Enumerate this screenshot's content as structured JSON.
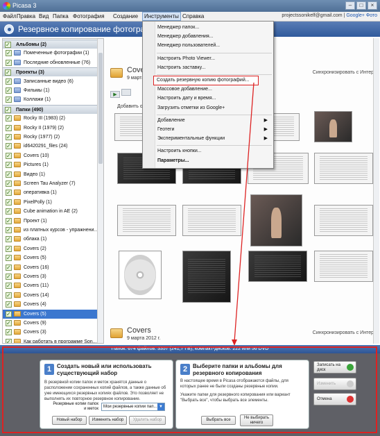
{
  "window": {
    "title": "Picasa 3"
  },
  "menu": {
    "items": [
      "Файл",
      "Правка",
      "Вид",
      "Папка",
      "Фотография",
      "Создание",
      "Инструменты",
      "Справка"
    ],
    "account": "projectssonikelf@gmail.com",
    "google_link": "Google+ Фото"
  },
  "header": {
    "title": "Резервное копирование фотограф"
  },
  "sidebar": {
    "rows": [
      {
        "label": "Альбомы (2)",
        "type": "section"
      },
      {
        "label": "Помеченные фотографии (1)",
        "type": "album"
      },
      {
        "label": "Последние обновленные (76)",
        "type": "album"
      },
      {
        "label": "Проекты (3)",
        "type": "section"
      },
      {
        "label": "Записанные видео (6)",
        "type": "album"
      },
      {
        "label": "Фильмы (1)",
        "type": "album"
      },
      {
        "label": "Коллажи (1)",
        "type": "album"
      },
      {
        "label": "Папки (490)",
        "type": "section"
      },
      {
        "label": "Rocky III (1983) (2)",
        "type": "folder"
      },
      {
        "label": "Rocky II (1979) (2)",
        "type": "folder"
      },
      {
        "label": "Rocky (1977) (2)",
        "type": "folder"
      },
      {
        "label": "id6420291_files (24)",
        "type": "folder"
      },
      {
        "label": "Covers (10)",
        "type": "folder"
      },
      {
        "label": "Pictures (1)",
        "type": "folder"
      },
      {
        "label": "Видео (1)",
        "type": "folder"
      },
      {
        "label": "Screen Tau Analyzer (7)",
        "type": "folder"
      },
      {
        "label": "оперативка (1)",
        "type": "folder"
      },
      {
        "label": "PixelPolly (1)",
        "type": "folder"
      },
      {
        "label": "Cube animation in AE (2)",
        "type": "folder"
      },
      {
        "label": "Проект (1)",
        "type": "folder"
      },
      {
        "label": "из платных курсов - упражнени...",
        "type": "folder"
      },
      {
        "label": "облака (1)",
        "type": "folder"
      },
      {
        "label": "Covers (2)",
        "type": "folder"
      },
      {
        "label": "Covers (5)",
        "type": "folder"
      },
      {
        "label": "Covers (16)",
        "type": "folder"
      },
      {
        "label": "Covers (3)",
        "type": "folder"
      },
      {
        "label": "Covers (11)",
        "type": "folder"
      },
      {
        "label": "Covers (14)",
        "type": "folder"
      },
      {
        "label": "Covers (4)",
        "type": "folder"
      },
      {
        "label": "Covers (5)",
        "type": "folder",
        "selected": true
      },
      {
        "label": "Covers (9)",
        "type": "folder"
      },
      {
        "label": "Covers (3)",
        "type": "folder"
      },
      {
        "label": "Как работать в программе Son...",
        "type": "folder"
      }
    ]
  },
  "main": {
    "album_top": {
      "name": "Covers",
      "date": "9 марта",
      "sync": "Синхронизировать с Интер"
    },
    "add_description": "Добавить о",
    "album_bottom": {
      "name": "Covers",
      "date": "9 марта 2012 г.",
      "sync": "Синхронизировать с Интер"
    }
  },
  "dropdown": {
    "items": [
      {
        "label": "Менеджер папок...",
        "group": 1
      },
      {
        "label": "Менеджер добавления...",
        "group": 1
      },
      {
        "label": "Менеджер пользователей...",
        "group": 1
      },
      {
        "label": "Настроить Photo Viewer...",
        "group": 2
      },
      {
        "label": "Настроить заставку...",
        "group": 2
      },
      {
        "label": "Создать резервную копию фотографий...",
        "group": 3,
        "highlight": true
      },
      {
        "label": "Массовое добавление...",
        "group": 3
      },
      {
        "label": "Настроить дату и время...",
        "group": 3
      },
      {
        "label": "Загрузить отметки из Google+",
        "group": 3
      },
      {
        "label": "Добавление",
        "group": 4,
        "submenu": true
      },
      {
        "label": "Геотеги",
        "group": 4,
        "submenu": true
      },
      {
        "label": "Экспериментальные функции",
        "group": 4,
        "submenu": true
      },
      {
        "label": "Настроить кнопки...",
        "group": 5
      },
      {
        "label": "Параметры...",
        "group": 5,
        "bold": true
      }
    ]
  },
  "status": {
    "text": "Папок: 674 файлов: 3357 (241,7 ГБ), компакт-дисков: 222  или  56 DVD"
  },
  "backup": {
    "step1": {
      "number": "1",
      "title": "Создать новый или использовать существующий набор",
      "desc": "В резервной копии папок и меток хранятся данные о расположении сохраненных копий файлов, а также данные об уже имеющихся резервных копиях файлов. Это позволяет не выполнять их повторное резервное копирование.",
      "set_label": "Резервные копии папок и меток",
      "set_value": "Мои резервные копии пап...",
      "new_set": "Новый набор",
      "edit_set": "Изменить набор",
      "delete_set": "Удалить набор"
    },
    "step2": {
      "number": "2",
      "title": "Выберите папки и альбомы для резервного копирования",
      "desc1": "В настоящее время в Picasa отображаются файлы, для которых ранее не были созданы резервные копии.",
      "desc2": "Укажите папки для резервного копирования или вариант \"Выбрать все\", чтобы выбрать все элементы.",
      "select_all": "Выбрать все",
      "select_none": "Не выбирать ничего"
    },
    "burn": "Записать на диск",
    "change": "Изменить",
    "cancel": "Отмена"
  },
  "colors": {
    "accent": "#3b77cf",
    "annotation": "#dd2222",
    "header": "#2f5a9c"
  }
}
